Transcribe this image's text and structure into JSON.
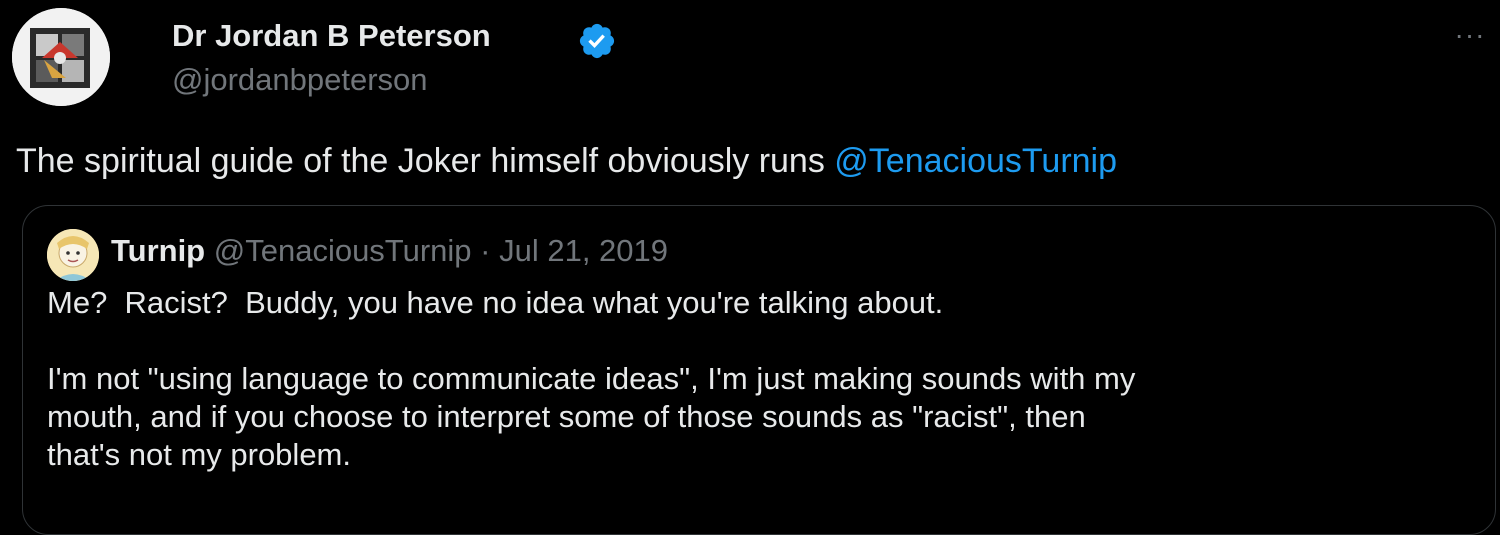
{
  "tweet": {
    "author": {
      "display_name": "Dr Jordan B Peterson",
      "handle": "@jordanbpeterson",
      "verified_icon": "verified-badge-icon"
    },
    "more_icon": "more-options-icon",
    "text_prefix": "The spiritual guide of the Joker himself obviously runs ",
    "mention": "@TenaciousTurnip",
    "quoted_tweet": {
      "author_name": "Turnip",
      "author_handle": "@TenaciousTurnip",
      "separator": "·",
      "date": "Jul 21, 2019",
      "paragraphs": [
        "Me?  Racist?  Buddy, you have no idea what you're talking about.",
        "I'm not \"using language to communicate ideas\", I'm just making sounds with my\nmouth, and if you choose to interpret some of those sounds as \"racist\", then\nthat's not my problem."
      ]
    }
  },
  "colors": {
    "background": "#000000",
    "text": "#e7e9ea",
    "secondary": "#71767b",
    "link": "#1d9bf0",
    "border": "#2f3336"
  }
}
